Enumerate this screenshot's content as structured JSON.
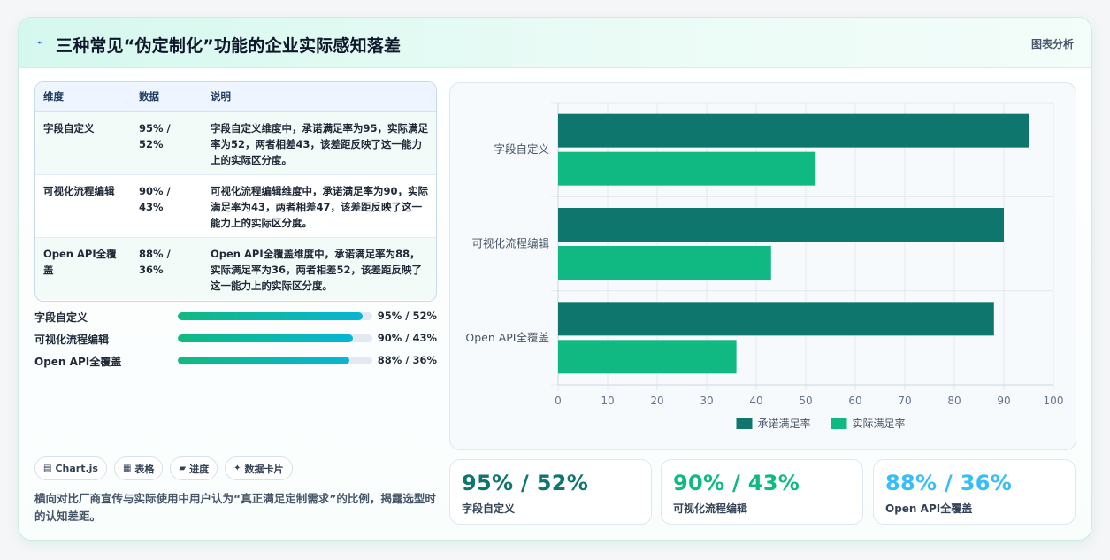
{
  "header": {
    "title": "三种常见“伪定制化”功能的企业实际感知落差",
    "tag": "图表分析",
    "icon": "spark-icon"
  },
  "table": {
    "headers": [
      "维度",
      "数据",
      "说明"
    ],
    "rows": [
      {
        "dim": "字段自定义",
        "data": "95% / 52%",
        "desc": "字段自定义维度中，承诺满足率为95，实际满足率为52，两者相差43，该差距反映了这一能力上的实际区分度。"
      },
      {
        "dim": "可视化流程编辑",
        "data": "90% / 43%",
        "desc": "可视化流程编辑维度中，承诺满足率为90，实际满足率为43，两者相差47，该差距反映了这一能力上的实际区分度。"
      },
      {
        "dim": "Open API全覆盖",
        "data": "88% / 36%",
        "desc": "Open API全覆盖维度中，承诺满足率为88，实际满足率为36，两者相差52，该差距反映了这一能力上的实际区分度。"
      }
    ]
  },
  "progress": [
    {
      "label": "字段自定义",
      "value": "95% / 52%",
      "fill": 95
    },
    {
      "label": "可视化流程编辑",
      "value": "90% / 43%",
      "fill": 90
    },
    {
      "label": "Open API全覆盖",
      "value": "88% / 36%",
      "fill": 88
    }
  ],
  "chips": [
    {
      "label": "Chart.js",
      "icon": "chart-icon"
    },
    {
      "label": "表格",
      "icon": "table-icon"
    },
    {
      "label": "进度",
      "icon": "progress-icon"
    },
    {
      "label": "数据卡片",
      "icon": "sparkle-icon"
    }
  ],
  "note": "横向对比厂商宣传与实际使用中用户认为“真正满足定制需求”的比例，揭露选型时的认知差距。",
  "kpis": [
    {
      "value": "95% / 52%",
      "label": "字段自定义",
      "color": "#0f766e"
    },
    {
      "value": "90% / 43%",
      "label": "可视化流程编辑",
      "color": "#10b981"
    },
    {
      "value": "88% / 36%",
      "label": "Open API全覆盖",
      "color": "#38bdf8"
    }
  ],
  "chart_data": {
    "type": "bar",
    "orientation": "horizontal",
    "categories": [
      "字段自定义",
      "可视化流程编辑",
      "Open API全覆盖"
    ],
    "series": [
      {
        "name": "承诺满足率",
        "values": [
          95,
          90,
          88
        ],
        "color": "#0f766e"
      },
      {
        "name": "实际满足率",
        "values": [
          52,
          43,
          36
        ],
        "color": "#10b981"
      }
    ],
    "xlim": [
      0,
      100
    ],
    "xticks": [
      "0",
      "10",
      "20",
      "30",
      "40",
      "50",
      "60",
      "70",
      "80",
      "90",
      "100"
    ],
    "grid": true,
    "legend": "bottom"
  }
}
